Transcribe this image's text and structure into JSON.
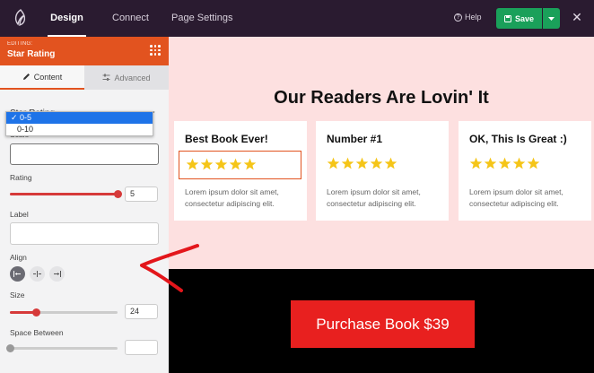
{
  "topbar": {
    "tabs": [
      {
        "label": "Design",
        "active": true
      },
      {
        "label": "Connect",
        "active": false
      },
      {
        "label": "Page Settings",
        "active": false
      }
    ],
    "help_label": "Help",
    "save_label": "Save",
    "colors": {
      "bar": "#2a1b30",
      "save": "#1aa05a"
    }
  },
  "sidebar": {
    "editing_label": "EDITING:",
    "editing_title": "Star Rating",
    "tabs": {
      "content": "Content",
      "advanced": "Advanced"
    },
    "section_title": "Star Rating",
    "scale": {
      "label": "Scale",
      "options": [
        "0-5",
        "0-10"
      ],
      "selected": "0-5"
    },
    "rating": {
      "label": "Rating",
      "value": "5",
      "max": 5
    },
    "label_field": {
      "label": "Label",
      "value": ""
    },
    "align": {
      "label": "Align",
      "options": [
        "left",
        "center",
        "right"
      ],
      "selected": "left"
    },
    "size": {
      "label": "Size",
      "value": "24"
    },
    "space_between": {
      "label": "Space Between",
      "value": ""
    },
    "accent_color": "#e2531f"
  },
  "canvas": {
    "heading": "Our Readers Are Lovin' It",
    "background": "#fde0e0",
    "cards": [
      {
        "title": "Best Book Ever!",
        "stars": 5,
        "text": "Lorem ipsum dolor sit amet, consectetur adipiscing elit."
      },
      {
        "title": "Number #1",
        "stars": 5,
        "text": "Lorem ipsum dolor sit amet, consectetur adipiscing elit."
      },
      {
        "title": "OK, This Is Great :)",
        "stars": 5,
        "text": "Lorem ipsum dolor sit amet, consectetur adipiscing elit."
      }
    ],
    "star_color": "#f5c518",
    "purchase_button": "Purchase Book $39",
    "purchase_color": "#e8201f"
  }
}
